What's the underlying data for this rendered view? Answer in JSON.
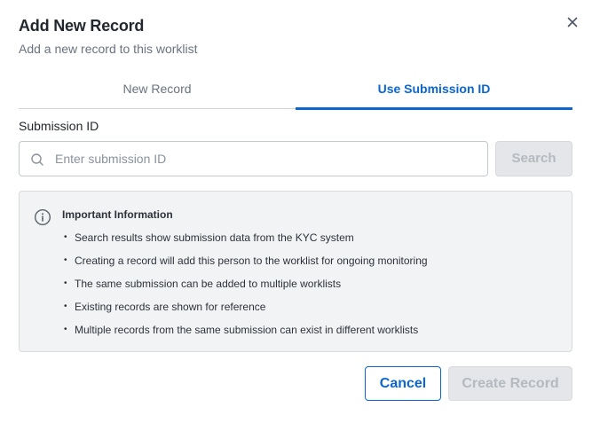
{
  "dialog": {
    "title": "Add New Record",
    "subtitle": "Add a new record to this worklist",
    "close_icon": "close-icon"
  },
  "tabs": [
    {
      "label": "New Record",
      "active": false
    },
    {
      "label": "Use Submission ID",
      "active": true
    }
  ],
  "form": {
    "field_label": "Submission ID",
    "input_value": "",
    "input_placeholder": "Enter submission ID",
    "search_icon": "search-icon",
    "search_button_label": "Search",
    "search_button_disabled": true
  },
  "info": {
    "icon": "info-icon",
    "heading": "Important Information",
    "items": [
      "Search results show submission data from the KYC system",
      "Creating a record will add this person to the worklist for ongoing monitoring",
      "The same submission can be added to multiple worklists",
      "Existing records are shown for reference",
      "Multiple records from the same submission can exist in different worklists"
    ]
  },
  "footer": {
    "cancel_label": "Cancel",
    "create_label": "Create Record",
    "create_disabled": true
  },
  "colors": {
    "accent": "#0b66d0",
    "disabled_bg": "#e4e6e9",
    "disabled_text": "#b5bac1",
    "info_bg": "#f2f3f5"
  }
}
